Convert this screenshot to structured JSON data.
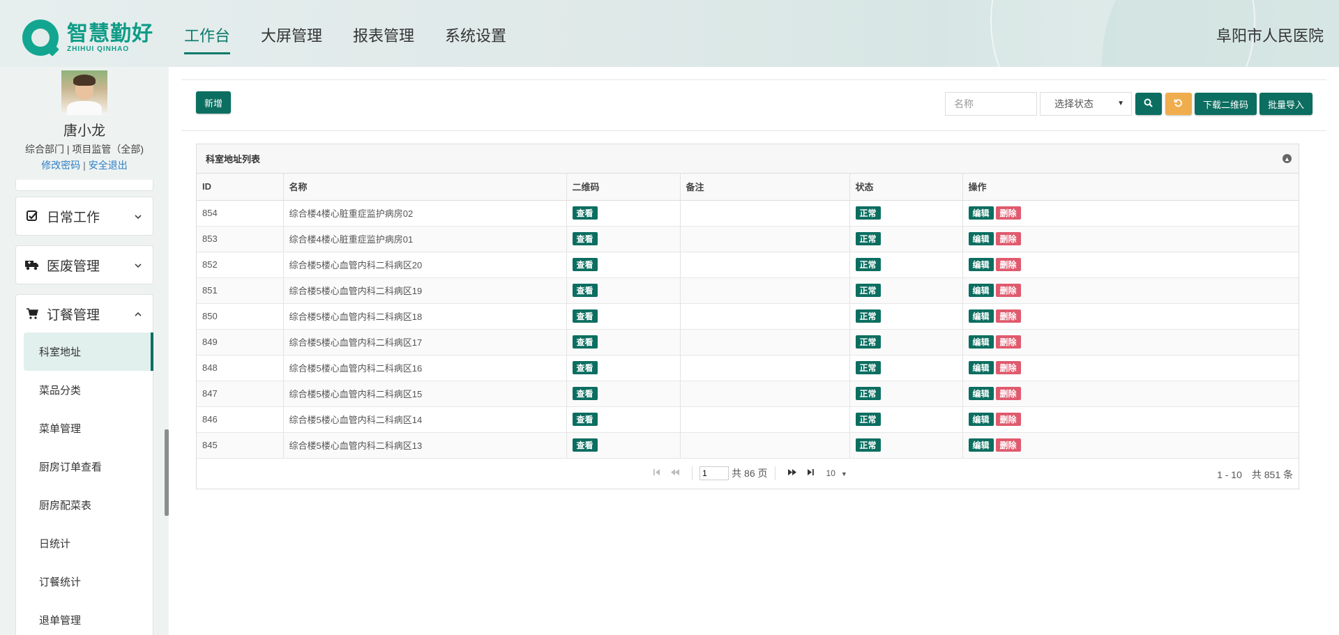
{
  "header": {
    "logo_cn": "智慧勤好",
    "logo_en": "ZHIHUI QINHAO",
    "nav": [
      "工作台",
      "大屏管理",
      "报表管理",
      "系统设置"
    ],
    "hospital": "阜阳市人民医院"
  },
  "user": {
    "name": "唐小龙",
    "dept": "综合部门 | 项目监管（全部)",
    "change_password": "修改密码",
    "separator": " | ",
    "logout": "安全退出"
  },
  "sidebar": {
    "groups": [
      {
        "label": "日常工作",
        "icon": "checkbox-icon",
        "expanded": false
      },
      {
        "label": "医废管理",
        "icon": "truck-icon",
        "expanded": false
      },
      {
        "label": "订餐管理",
        "icon": "cart-icon",
        "expanded": true
      }
    ],
    "submenu": [
      "科室地址",
      "菜品分类",
      "菜单管理",
      "厨房订单查看",
      "厨房配菜表",
      "日统计",
      "订餐统计",
      "退单管理"
    ],
    "active": "科室地址"
  },
  "toolbar": {
    "add": "新增",
    "search_placeholder": "名称",
    "status_select": "选择状态",
    "download_qr": "下载二维码",
    "batch_import": "批量导入"
  },
  "panel": {
    "title": "科室地址列表",
    "columns": [
      "ID",
      "名称",
      "二维码",
      "备注",
      "状态",
      "操作"
    ],
    "view_label": "查看",
    "edit_label": "编辑",
    "delete_label": "删除",
    "rows": [
      {
        "id": "854",
        "name": "综合楼4楼心脏重症监护病房02",
        "remark": "",
        "status": "正常"
      },
      {
        "id": "853",
        "name": "综合楼4楼心脏重症监护病房01",
        "remark": "",
        "status": "正常"
      },
      {
        "id": "852",
        "name": "综合楼5楼心血管内科二科病区20",
        "remark": "",
        "status": "正常"
      },
      {
        "id": "851",
        "name": "综合楼5楼心血管内科二科病区19",
        "remark": "",
        "status": "正常"
      },
      {
        "id": "850",
        "name": "综合楼5楼心血管内科二科病区18",
        "remark": "",
        "status": "正常"
      },
      {
        "id": "849",
        "name": "综合楼5楼心血管内科二科病区17",
        "remark": "",
        "status": "正常"
      },
      {
        "id": "848",
        "name": "综合楼5楼心血管内科二科病区16",
        "remark": "",
        "status": "正常"
      },
      {
        "id": "847",
        "name": "综合楼5楼心血管内科二科病区15",
        "remark": "",
        "status": "正常"
      },
      {
        "id": "846",
        "name": "综合楼5楼心血管内科二科病区14",
        "remark": "",
        "status": "正常"
      },
      {
        "id": "845",
        "name": "综合楼5楼心血管内科二科病区13",
        "remark": "",
        "status": "正常"
      }
    ]
  },
  "pager": {
    "page": "1",
    "total_pages": "共 86 页",
    "page_size": "10",
    "info": "1 - 10　共 851 条"
  },
  "colors": {
    "primary": "#0b6e60",
    "danger": "#e05a6d",
    "warning": "#f0ad4e",
    "brand": "#0f9c87"
  }
}
